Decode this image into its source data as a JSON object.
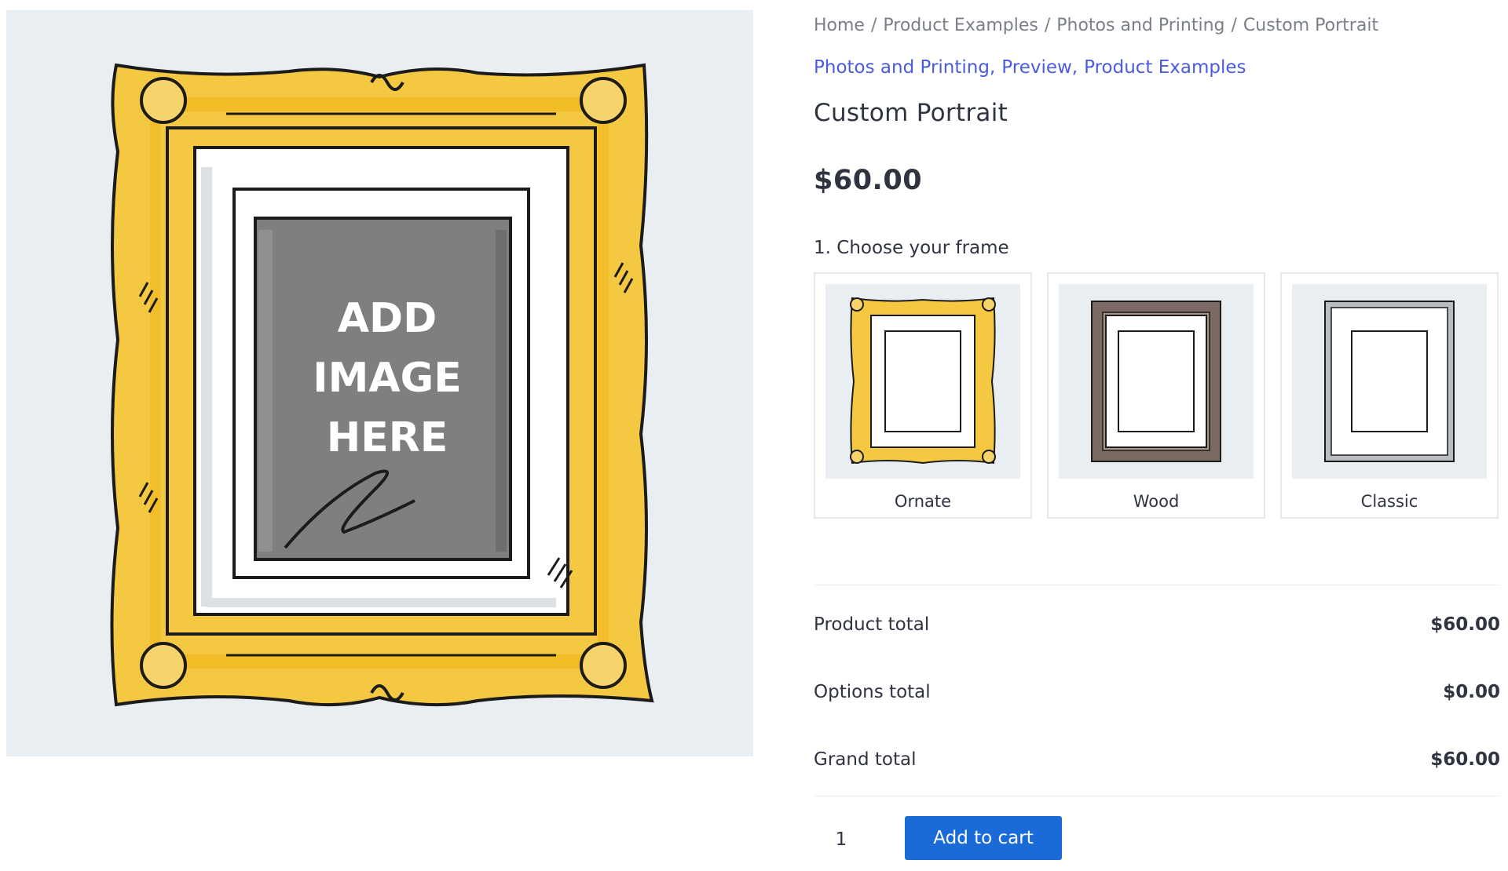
{
  "breadcrumb": {
    "items": [
      "Home",
      "Product Examples",
      "Photos and Printing",
      "Custom Portrait"
    ],
    "separator": "/"
  },
  "categories": {
    "links": [
      "Photos and Printing",
      "Preview",
      "Product Examples"
    ],
    "separator": ","
  },
  "product": {
    "title": "Custom Portrait",
    "price": "$60.00",
    "image_placeholder": [
      "ADD",
      "IMAGE",
      "HERE"
    ]
  },
  "options": {
    "label": "1. Choose your frame",
    "frames": [
      {
        "label": "Ornate",
        "icon": "ornate-frame-icon"
      },
      {
        "label": "Wood",
        "icon": "wood-frame-icon"
      },
      {
        "label": "Classic",
        "icon": "classic-frame-icon"
      }
    ]
  },
  "totals": {
    "product_total": {
      "label": "Product total",
      "value": "$60.00"
    },
    "options_total": {
      "label": "Options total",
      "value": "$0.00"
    },
    "grand_total": {
      "label": "Grand total",
      "value": "$60.00"
    }
  },
  "cart": {
    "quantity": "1",
    "add_to_cart_label": "Add to cart"
  },
  "colors": {
    "link": "#4a5be0",
    "button": "#1a6ad8",
    "image_background": "#e9eef3",
    "ornate_gold": "#f5c842",
    "wood_brown": "#7a6a63",
    "classic_gray": "#b9bcc0"
  }
}
